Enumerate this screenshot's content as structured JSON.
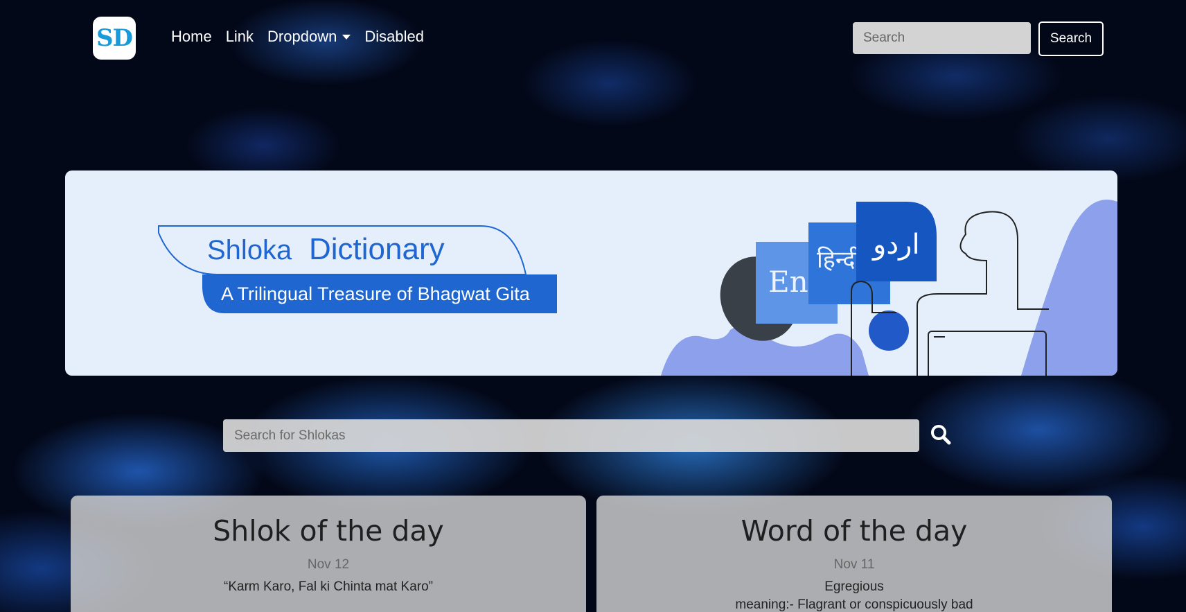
{
  "navbar": {
    "logo_text": "SD",
    "links": [
      {
        "label": "Home"
      },
      {
        "label": "Link"
      },
      {
        "label": "Dropdown"
      },
      {
        "label": "Disabled"
      }
    ],
    "search_placeholder": "Search",
    "search_button": "Search"
  },
  "banner": {
    "title_part1": "Shloka",
    "title_part2": "Dictionary",
    "subtitle": "A Trilingual Treasure of Bhagwat Gita",
    "lang_english": "Eng",
    "lang_hindi": "हिन्दी",
    "lang_urdu": "اردو"
  },
  "main_search": {
    "placeholder": "Search for Shlokas",
    "icon": "search-icon"
  },
  "cards": {
    "shlok": {
      "title": "Shlok of the day",
      "date": "Nov 12",
      "text": "“Karm Karo, Fal ki Chinta mat Karo”"
    },
    "word": {
      "title": "Word of the day",
      "date": "Nov 11",
      "text": "Egregious",
      "meaning": "meaning:- Flagrant or conspicuously bad"
    }
  },
  "colors": {
    "background": "#030818",
    "banner_bg": "#e5effc",
    "brand_blue": "#1f66d1",
    "logo_blue": "#1a9ad8",
    "card_bg": "#d2d2d2"
  }
}
